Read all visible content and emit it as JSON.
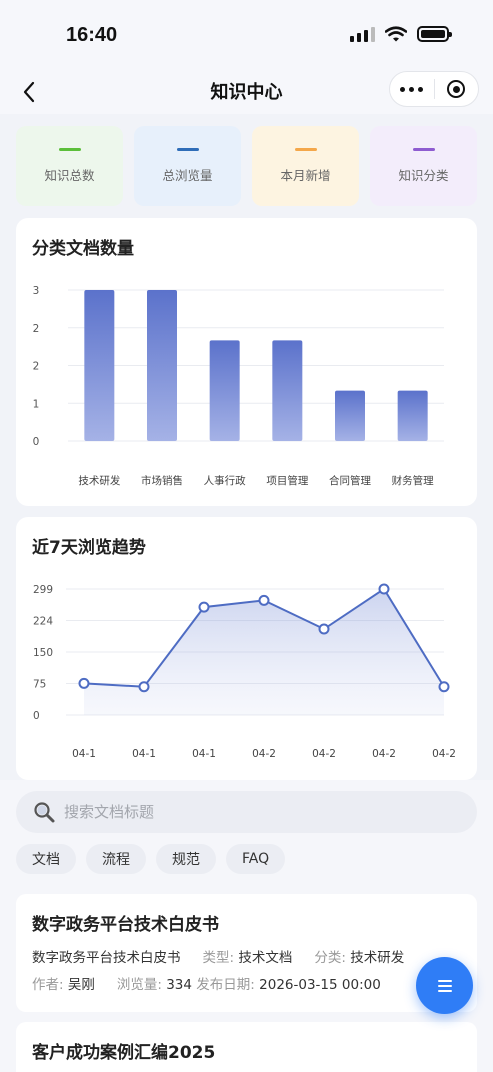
{
  "status_bar": {
    "time": "16:40"
  },
  "nav": {
    "title": "知识中心"
  },
  "stats": [
    {
      "label": "知识总数",
      "color": "#5bbf3a",
      "bg": "#edf7ec"
    },
    {
      "label": "总浏览量",
      "color": "#2f6db8",
      "bg": "#e7f0fb"
    },
    {
      "label": "本月新增",
      "color": "#f4a74a",
      "bg": "#fdf4e1"
    },
    {
      "label": "知识分类",
      "color": "#8e5cd0",
      "bg": "#f3edfb"
    }
  ],
  "bar_chart": {
    "title": "分类文档数量"
  },
  "line_chart": {
    "title": "近7天浏览趋势"
  },
  "chart_data": [
    {
      "type": "bar",
      "title": "分类文档数量",
      "categories": [
        "技术研发",
        "市场销售",
        "人事行政",
        "项目管理",
        "合同管理",
        "财务管理"
      ],
      "values": [
        3,
        3,
        2,
        2,
        1,
        1
      ],
      "y_tick_labels": [
        "0",
        "1",
        "2",
        "2",
        "3"
      ],
      "ylim": [
        0,
        3
      ],
      "grid": true,
      "color": "#5b74cc"
    },
    {
      "type": "area",
      "title": "近7天浏览趋势",
      "categories": [
        "04-1",
        "04-1",
        "04-1",
        "04-2",
        "04-2",
        "04-2",
        "04-2"
      ],
      "values": [
        75,
        67,
        256,
        272,
        204,
        299,
        67
      ],
      "y_tick_labels": [
        "0",
        "75",
        "150",
        "224",
        "299"
      ],
      "ylim": [
        0,
        299
      ],
      "grid": true,
      "color": "#4e6cc3"
    }
  ],
  "search": {
    "placeholder": "搜索文档标题"
  },
  "filters": [
    "文档",
    "流程",
    "规范",
    "FAQ"
  ],
  "documents": [
    {
      "title": "数字政务平台技术白皮书",
      "subtitle": "数字政务平台技术白皮书",
      "type_label": "类型:",
      "type": "技术文档",
      "category_label": "分类:",
      "category": "技术研发",
      "author_label": "作者:",
      "author": "吴刚",
      "views_label": "浏览量:",
      "views": "334",
      "date_label": "发布日期:",
      "date": "2026-03-15 00:00"
    },
    {
      "title": "客户成功案例汇编2025"
    }
  ]
}
